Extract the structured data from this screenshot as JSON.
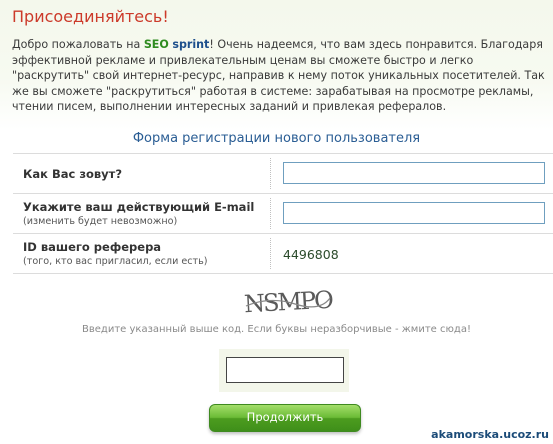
{
  "hero": {
    "title": "Присоединяйтесь!",
    "intro_before": "Добро пожаловать на ",
    "brand_seo": "SEO",
    "brand_space": " ",
    "brand_sprint": "sprint",
    "intro_after": "! Очень надеемся, что вам здесь понравится. Благодаря эффективной рекламе и привлекательным ценам вы сможете быстро и легко \"раскрутить\" свой интернет-ресурс, направив к нему поток уникальных посетителей. Так же вы сможете \"раскрутиться\" работая в системе: зарабатывая на просмотре рекламы, чтении писем, выполнении интересных заданий и привлекая рефералов."
  },
  "form": {
    "title": "Форма регистрации нового пользователя",
    "name_label": "Как Вас зовут?",
    "name_value": "",
    "email_label": "Укажите ваш действующий E-mail",
    "email_sublabel": "(изменить будет невозможно)",
    "email_value": "",
    "referrer_label": "ID вашего реферера",
    "referrer_sublabel": "(того, кто вас пригласил, если есть)",
    "referrer_value": "4496808"
  },
  "captcha": {
    "image_text": "NSMPO",
    "hint": "Введите указанный выше код. Если буквы неразборчивые - жмите сюда!",
    "value": ""
  },
  "submit_label": "Продолжить",
  "watermark": "akamorska.ucoz.ru",
  "colors": {
    "title_red": "#cc3a2a",
    "form_title_blue": "#2a5d94",
    "button_green": "#5aa82a",
    "input_border": "#6f9fbf"
  }
}
